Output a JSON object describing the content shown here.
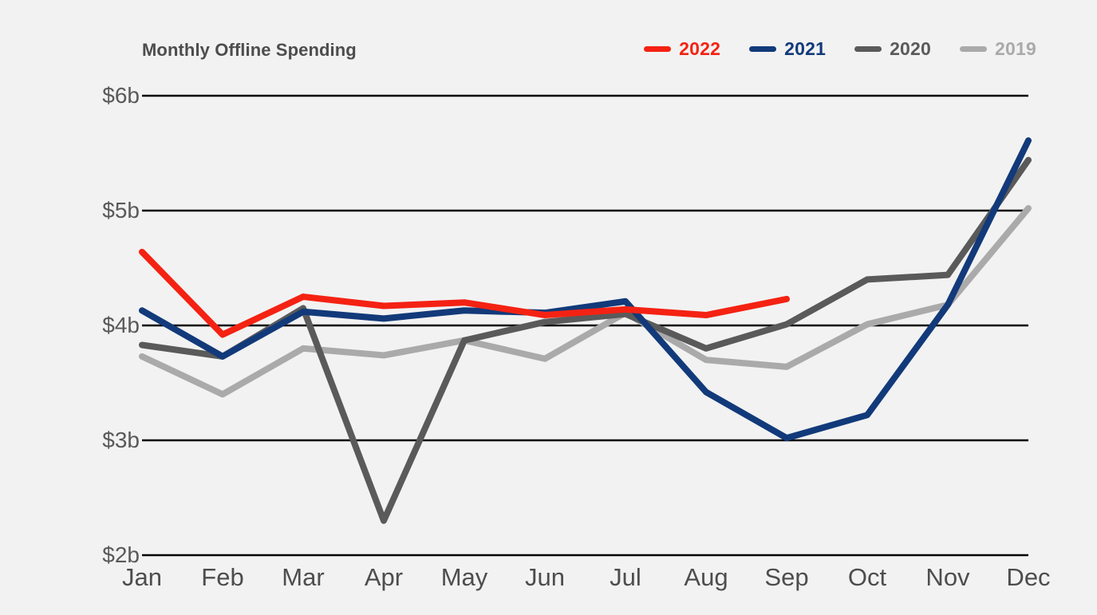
{
  "chart_data": {
    "type": "line",
    "title": "Monthly Offline Spending",
    "xlabel": "",
    "ylabel": "",
    "ylim": [
      2,
      6
    ],
    "yticks": [
      6,
      5,
      4,
      3,
      2
    ],
    "ytick_labels": [
      "$6b",
      "$5b",
      "$4b",
      "$3b",
      "$2b"
    ],
    "grid": "horizontal",
    "legend_position": "top-right",
    "units": "billions of USD",
    "categories": [
      "Jan",
      "Feb",
      "Mar",
      "Apr",
      "May",
      "Jun",
      "Jul",
      "Aug",
      "Sep",
      "Oct",
      "Nov",
      "Dec"
    ],
    "series": [
      {
        "name": "2022",
        "color": "#f42213",
        "values": [
          4.64,
          3.92,
          4.25,
          4.17,
          4.2,
          4.09,
          4.14,
          4.09,
          4.23,
          null,
          null,
          null
        ]
      },
      {
        "name": "2021",
        "color": "#123a7a",
        "values": [
          4.13,
          3.73,
          4.12,
          4.06,
          4.13,
          4.11,
          4.21,
          3.42,
          3.02,
          3.22,
          4.18,
          5.61
        ]
      },
      {
        "name": "2020",
        "color": "#5a5a5a",
        "values": [
          3.83,
          3.73,
          4.15,
          2.3,
          3.87,
          4.03,
          4.1,
          3.8,
          4.01,
          4.4,
          4.44,
          5.44
        ]
      },
      {
        "name": "2019",
        "color": "#aaaaaa",
        "values": [
          3.73,
          3.4,
          3.8,
          3.74,
          3.87,
          3.71,
          4.11,
          3.7,
          3.64,
          4.01,
          4.18,
          5.02
        ]
      }
    ]
  },
  "legend": {
    "items": [
      {
        "label": "2022",
        "color": "#f42213"
      },
      {
        "label": "2021",
        "color": "#123a7a"
      },
      {
        "label": "2020",
        "color": "#5a5a5a"
      },
      {
        "label": "2019",
        "color": "#aaaaaa"
      }
    ]
  },
  "axis_colors": {
    "gridline": "#000000",
    "tick_text": "#595959",
    "title_text": "#4d4d4d",
    "background": "#f2f2f2"
  }
}
